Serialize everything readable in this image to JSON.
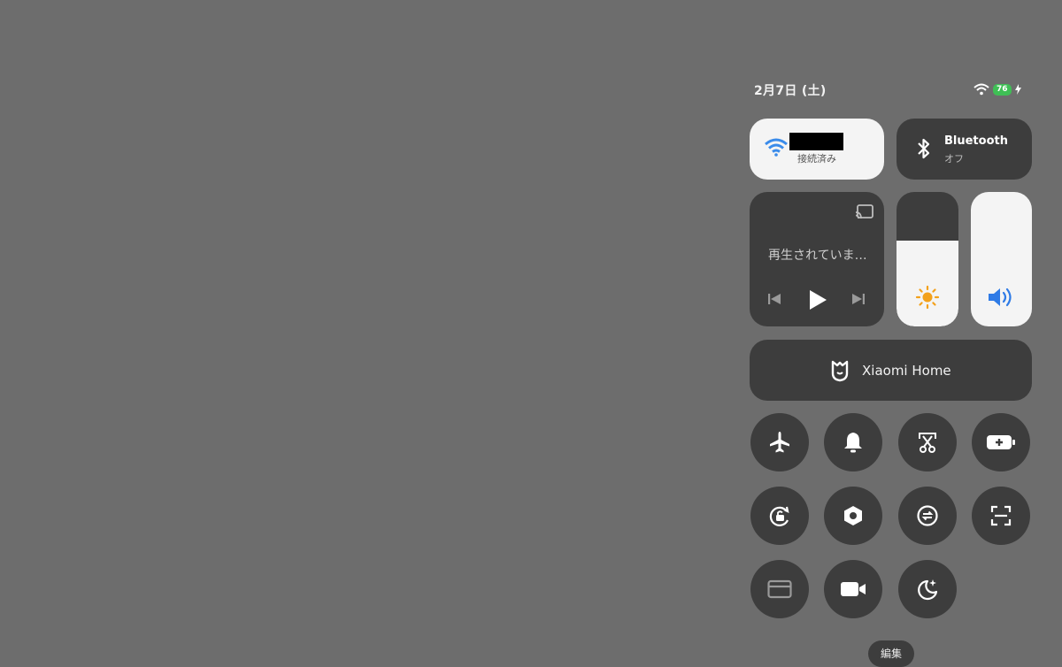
{
  "status": {
    "date": "2月7日 (土)",
    "battery": "76",
    "icons": [
      "wifi-icon",
      "battery-icon",
      "charging-icon"
    ]
  },
  "wifi": {
    "name_redacted": true,
    "status": "接続済み",
    "color": "#3a8bea"
  },
  "bluetooth": {
    "title": "Bluetooth",
    "status": "オフ"
  },
  "media": {
    "title": "再生されていま…",
    "controls": [
      "previous-icon",
      "play-icon",
      "next-icon"
    ],
    "cast_icon": "cast-icon"
  },
  "brightness": {
    "level": 0.64,
    "icon": "sun-icon",
    "color": "#f3a11b"
  },
  "volume": {
    "level": 1.0,
    "icon": "speaker-icon",
    "color": "#2f7be6"
  },
  "home": {
    "label": "Xiaomi Home",
    "icon": "mi-home-icon"
  },
  "toggles": [
    "airplane-icon",
    "bell-icon",
    "screenshot-icon",
    "battery-saver-icon",
    "rotation-lock-icon",
    "settings-hex-icon",
    "sync-icon",
    "scan-icon",
    "card-icon",
    "video-camera-icon",
    "night-mode-icon"
  ],
  "edit": {
    "label": "編集"
  }
}
